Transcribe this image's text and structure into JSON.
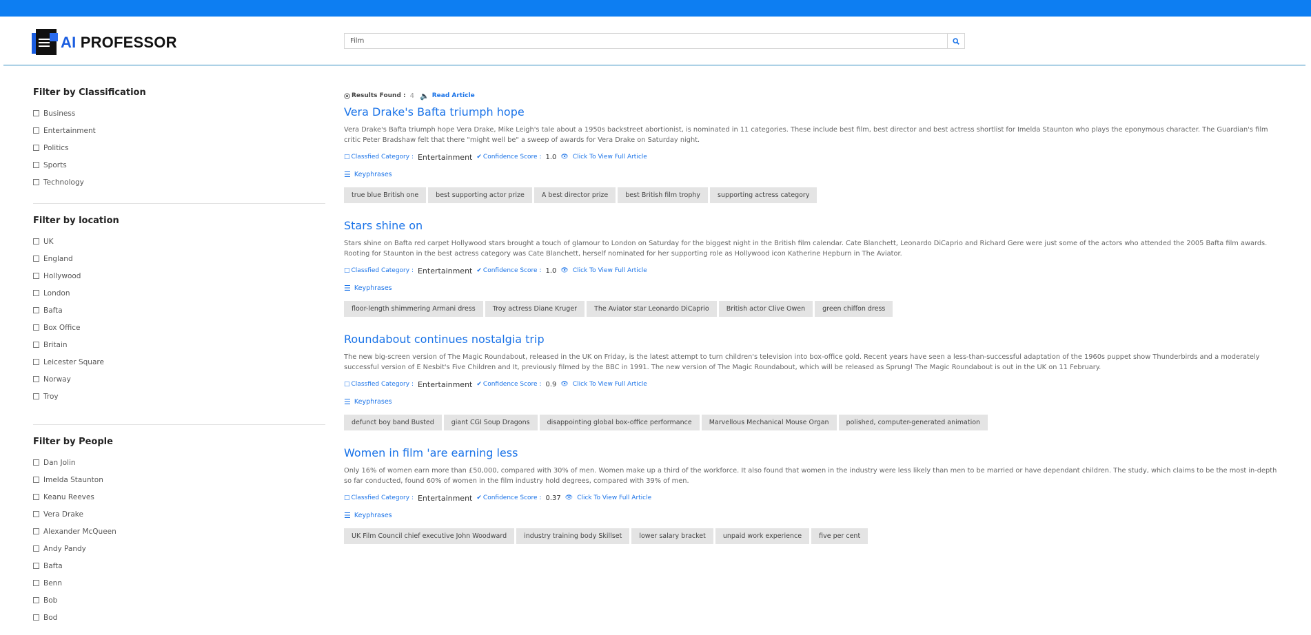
{
  "header": {
    "logo_ai": "AI",
    "logo_rest": " PROFESSOR",
    "search_value": "Film"
  },
  "sidebar": {
    "classification": {
      "title": "Filter by Classification",
      "items": [
        "Business",
        "Entertainment",
        "Politics",
        "Sports",
        "Technology"
      ]
    },
    "location": {
      "title": "Filter by location",
      "items": [
        "UK",
        "England",
        "Hollywood",
        "London",
        "Bafta",
        "Box Office",
        "Britain",
        "Leicester Square",
        "Norway",
        "Troy"
      ]
    },
    "people": {
      "title": "Filter by People",
      "items": [
        "Dan Jolin",
        "Imelda Staunton",
        "Keanu Reeves",
        "Vera Drake",
        "Alexander McQueen",
        "Andy Pandy",
        "Bafta",
        "Benn",
        "Bob",
        "Bod"
      ]
    }
  },
  "results": {
    "label": "Results Found :",
    "count": "4",
    "read_label": "Read Article"
  },
  "labels": {
    "category": "Classfied Category :",
    "confidence": "Confidence Score :",
    "view": "Click To View Full Article",
    "keyphrases": "Keyphrases"
  },
  "articles": [
    {
      "title": "Vera Drake's Bafta triumph hope",
      "body": "Vera Drake's Bafta triumph hope Vera Drake, Mike Leigh's tale about a 1950s backstreet abortionist, is nominated in 11 categories. These include best film, best director and best actress shortlist for Imelda Staunton who plays the eponymous character. The Guardian's film critic Peter Bradshaw felt that there \"might well be\" a sweep of awards for Vera Drake on Saturday night.",
      "category": "Entertainment",
      "score": "1.0",
      "tags": [
        "true blue British one",
        "best supporting actor prize",
        "A best director prize",
        "best British film trophy",
        "supporting actress category"
      ]
    },
    {
      "title": "Stars shine on",
      "body": "Stars shine on Bafta red carpet Hollywood stars brought a touch of glamour to London on Saturday for the biggest night in the British film calendar. Cate Blanchett, Leonardo DiCaprio and Richard Gere were just some of the actors who attended the 2005 Bafta film awards. Rooting for Staunton in the best actress category was Cate Blanchett, herself nominated for her supporting role as Hollywood icon Katherine Hepburn in The Aviator.",
      "category": "Entertainment",
      "score": "1.0",
      "tags": [
        "floor-length shimmering Armani dress",
        "Troy actress Diane Kruger",
        "The Aviator star Leonardo DiCaprio",
        "British actor Clive Owen",
        "green chiffon dress"
      ]
    },
    {
      "title": "Roundabout continues nostalgia trip",
      "body": "The new big-screen version of The Magic Roundabout, released in the UK on Friday, is the latest attempt to turn children's television into box-office gold. Recent years have seen a less-than-successful adaptation of the 1960s puppet show Thunderbirds and a moderately successful version of E Nesbit's Five Children and It, previously filmed by the BBC in 1991. The new version of The Magic Roundabout, which will be released as Sprung! The Magic Roundabout is out in the UK on 11 February.",
      "category": "Entertainment",
      "score": "0.9",
      "tags": [
        "defunct boy band Busted",
        "giant CGI Soup Dragons",
        "disappointing global box-office performance",
        "Marvellous Mechanical Mouse Organ",
        "polished, computer-generated animation"
      ]
    },
    {
      "title": "Women in film 'are earning less",
      "body": "Only 16% of women earn more than £50,000, compared with 30% of men. Women make up a third of the workforce. It also found that women in the industry were less likely than men to be married or have dependant children. The study, which claims to be the most in-depth so far conducted, found 60% of women in the film industry hold degrees, compared with 39% of men.",
      "category": "Entertainment",
      "score": "0.37",
      "tags": [
        "UK Film Council chief executive John Woodward",
        "industry training body Skillset",
        "lower salary bracket",
        "unpaid work experience",
        "five per cent"
      ]
    }
  ]
}
